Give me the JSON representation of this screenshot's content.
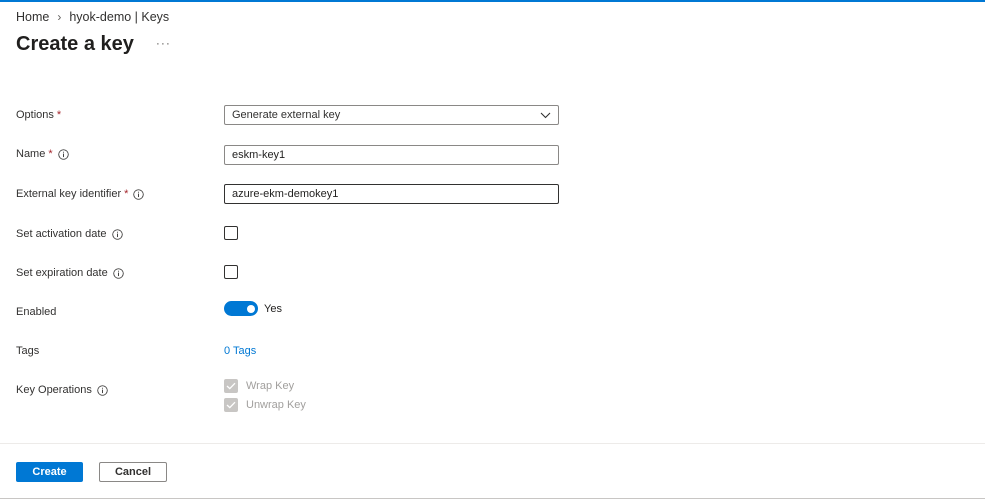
{
  "breadcrumb": {
    "items": [
      "Home",
      "hyok-demo | Keys"
    ],
    "separator": "›"
  },
  "page": {
    "title": "Create a key",
    "more": "···"
  },
  "form": {
    "options": {
      "label": "Options",
      "required": "*",
      "value": "Generate external key"
    },
    "name": {
      "label": "Name",
      "required": "*",
      "value": "eskm-key1",
      "info_icon": "info-icon"
    },
    "external_key_identifier": {
      "label": "External key identifier",
      "required": "*",
      "value": "azure-ekm-demokey1",
      "info_icon": "info-icon"
    },
    "set_activation_date": {
      "label": "Set activation date",
      "checked": false,
      "info_icon": "info-icon"
    },
    "set_expiration_date": {
      "label": "Set expiration date",
      "checked": false,
      "info_icon": "info-icon"
    },
    "enabled": {
      "label": "Enabled",
      "on": true,
      "value_label": "Yes"
    },
    "tags": {
      "label": "Tags",
      "link": "0 Tags"
    },
    "key_operations": {
      "label": "Key Operations",
      "info_icon": "info-icon",
      "items": [
        {
          "label": "Wrap Key",
          "checked": true,
          "disabled": true
        },
        {
          "label": "Unwrap Key",
          "checked": true,
          "disabled": true
        }
      ]
    }
  },
  "footer": {
    "create_label": "Create",
    "cancel_label": "Cancel"
  },
  "colors": {
    "accent": "#0078d4",
    "required": "#a4262c",
    "text": "#323130",
    "disabled": "#c8c6c4"
  }
}
